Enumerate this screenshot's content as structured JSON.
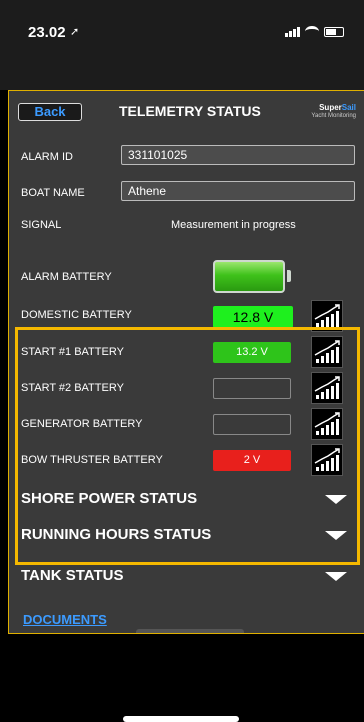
{
  "status_bar": {
    "time": "23.02"
  },
  "header": {
    "back_label": "Back",
    "title": "TELEMETRY STATUS",
    "logo_top_a": "Super",
    "logo_top_b": "Sail",
    "logo_bottom": "Yacht Monitoring"
  },
  "fields": {
    "alarm_id_label": "ALARM ID",
    "alarm_id_value": "331101025",
    "boat_name_label": "BOAT NAME",
    "boat_name_value": "Athene",
    "signal_label": "SIGNAL",
    "signal_value": "Measurement in progress"
  },
  "alarm_battery": {
    "label": "ALARM BATTERY",
    "level": "full",
    "color": "#3fc21b"
  },
  "batteries": [
    {
      "label": "DOMESTIC BATTERY",
      "value": "12.8 V",
      "color": "#1ef01e"
    },
    {
      "label": "START #1 BATTERY",
      "value": "13.2 V",
      "color": "#2ec41a"
    },
    {
      "label": "START #2 BATTERY",
      "value": "",
      "color": "#3a3a3a"
    },
    {
      "label": "GENERATOR BATTERY",
      "value": "",
      "color": "#3a3a3a"
    },
    {
      "label": "BOW THRUSTER BATTERY",
      "value": "2 V",
      "color": "#e8201c"
    }
  ],
  "sections": [
    {
      "label": "SHORE POWER STATUS"
    },
    {
      "label": "RUNNING HOURS STATUS"
    },
    {
      "label": "TANK STATUS"
    }
  ],
  "documents_label": "DOCUMENTS",
  "colors": {
    "accent": "#3c9bff",
    "highlight": "#f5b800",
    "panel": "#3a3a3a"
  },
  "icons": {
    "chart": "bar-chart-trend-icon",
    "expand": "triangle-down-icon"
  }
}
